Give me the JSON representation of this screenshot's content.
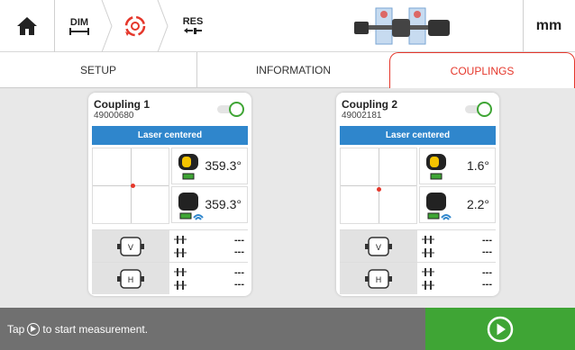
{
  "topbar": {
    "crumbs": [
      {
        "label": "DIM",
        "icon": "dimension-icon"
      },
      {
        "label": "",
        "icon": "coupling-edit-icon",
        "active": true
      },
      {
        "label": "RES",
        "icon": "results-icon"
      }
    ],
    "unit": "mm",
    "machine_icon": "machine-train-icon"
  },
  "tabs": [
    {
      "label": "SETUP"
    },
    {
      "label": "INFORMATION"
    },
    {
      "label": "COUPLINGS",
      "active": true
    }
  ],
  "couplings": [
    {
      "title": "Coupling 1",
      "serial": "49000680",
      "enabled": true,
      "status": "Laser centered",
      "sensor_angle": "359.3°",
      "sensor2_angle": "359.3°",
      "vertical": {
        "v1": "---",
        "v2": "---"
      },
      "horizontal": {
        "v1": "---",
        "v2": "---"
      }
    },
    {
      "title": "Coupling 2",
      "serial": "49002181",
      "enabled": true,
      "status": "Laser centered",
      "sensor_angle": "1.6°",
      "sensor2_angle": "2.2°",
      "vertical": {
        "v1": "---",
        "v2": "---"
      },
      "horizontal": {
        "v1": "---",
        "v2": "---"
      }
    }
  ],
  "bottom": {
    "hint_before": "Tap",
    "hint_after": "to start measurement."
  },
  "colors": {
    "accent": "#e5372b",
    "green": "#3fa535",
    "blue": "#2f86cc",
    "bar": "#707070"
  }
}
